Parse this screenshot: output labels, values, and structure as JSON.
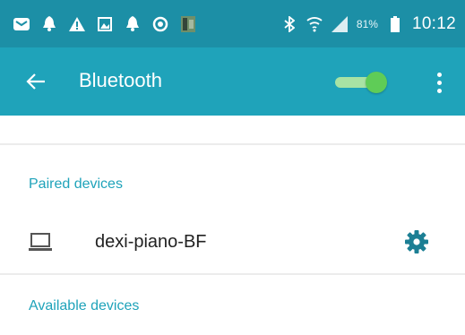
{
  "status_bar": {
    "left_icons": [
      "email-icon",
      "notification-icon",
      "warning-icon",
      "image-icon",
      "notification-icon",
      "sync-icon",
      "photo-icon"
    ],
    "right_icons": [
      "bluetooth-icon",
      "wifi-icon",
      "signal-icon",
      "battery-icon"
    ],
    "battery_percent": "81%",
    "time": "10:12"
  },
  "app_bar": {
    "title": "Bluetooth",
    "bluetooth_enabled": true,
    "colors": {
      "background": "#1fa3ba",
      "status_bar": "#1c8fa6",
      "toggle_on": "#5fcc57"
    }
  },
  "paired_devices": {
    "header": "Paired devices",
    "items": [
      {
        "name": "dexi-piano-BF",
        "icon": "laptop-icon",
        "action_icon": "gear-icon"
      }
    ]
  },
  "available_devices": {
    "header": "Available devices"
  }
}
